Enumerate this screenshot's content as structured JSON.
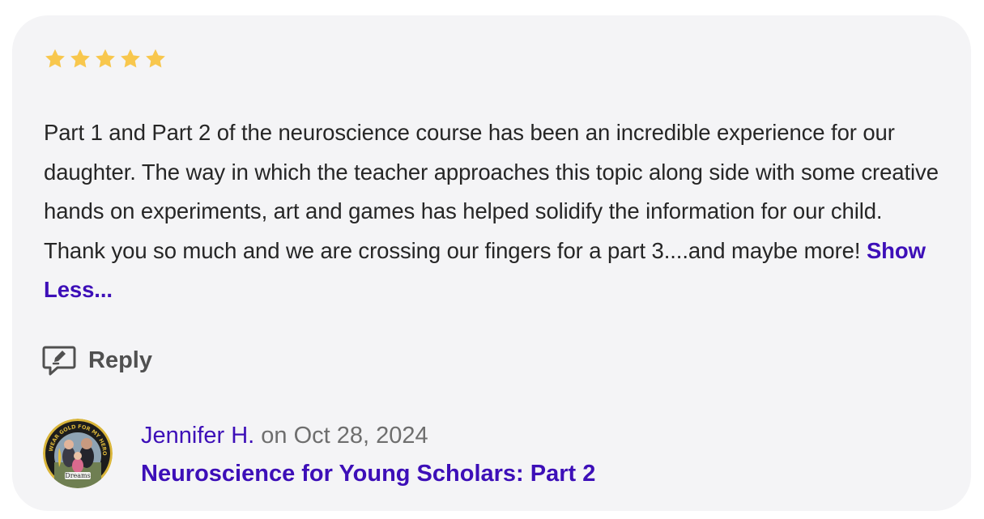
{
  "review": {
    "rating": 5,
    "rating_max": 5,
    "star_color": "#f8c74d",
    "text": "Part 1 and Part 2 of the neuroscience course has been an incredible experience for our daughter. The way in which the teacher approaches this topic along side with some creative hands on experiments, art and games has helped solidify the information for our child. Thank you so much and we are crossing our fingers for a part 3....and maybe more!",
    "show_less_label": "Show Less..."
  },
  "reply": {
    "label": "Reply",
    "icon": "reply-edit-icon"
  },
  "author": {
    "name": "Jennifer H.",
    "date_prefix": "on",
    "date": "Oct 28, 2024",
    "avatar_icon": "profile-photo",
    "avatar_badge_text": "I WEAR GOLD FOR MY HERO",
    "avatar_caption": "Dreams"
  },
  "course": {
    "title": "Neuroscience for Young Scholars: Part 2"
  },
  "colors": {
    "card_background": "#f4f4f6",
    "link_purple": "#3d0fb8",
    "body_text": "#262626",
    "muted_text": "#6e6e6e"
  }
}
